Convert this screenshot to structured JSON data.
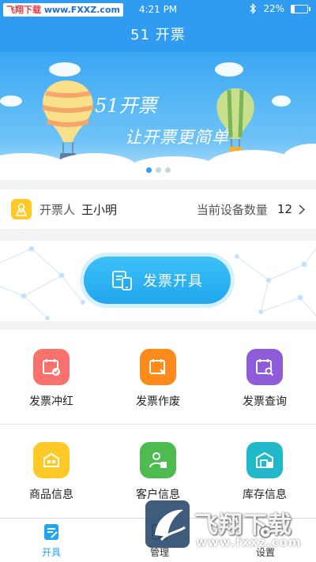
{
  "status_bar": {
    "badge_part1": "飞翔下载",
    "badge_part2": "www.FXXZ.com",
    "time": "4:21 PM",
    "battery": "22%",
    "battery_level": 0.22
  },
  "header": {
    "title": "51 开票"
  },
  "banner": {
    "slogan_line1": "51开票",
    "slogan_line2": "让开票更简单",
    "carousel_active_index": 0,
    "carousel_count": 3
  },
  "issuer": {
    "label": "开票人",
    "name": "王小明",
    "device_label": "当前设备数量",
    "device_count": "12"
  },
  "issue_button": {
    "label": "发票开具"
  },
  "functions": [
    {
      "label": "发票冲红",
      "icon": "invoice-red-icon",
      "color": "#f7716d"
    },
    {
      "label": "发票作废",
      "icon": "invoice-void-icon",
      "color": "#ff8a1c"
    },
    {
      "label": "发票查询",
      "icon": "invoice-search-icon",
      "color": "#8e5cd6"
    },
    {
      "label": "商品信息",
      "icon": "goods-icon",
      "color": "#ffc928"
    },
    {
      "label": "客户信息",
      "icon": "customer-icon",
      "color": "#4dbb4f"
    },
    {
      "label": "库存信息",
      "icon": "inventory-icon",
      "color": "#21b9c9"
    }
  ],
  "tabs": [
    {
      "label": "开具",
      "icon": "issue-tab-icon",
      "active": true
    },
    {
      "label": "管理",
      "icon": "manage-tab-icon",
      "active": false
    },
    {
      "label": "设置",
      "icon": "settings-tab-icon",
      "active": false
    }
  ],
  "watermark": {
    "title": "飞翔下载",
    "url": "www.fxxz.com"
  },
  "colors": {
    "primary": "#2f9cf2",
    "button": "#21a6ee"
  }
}
